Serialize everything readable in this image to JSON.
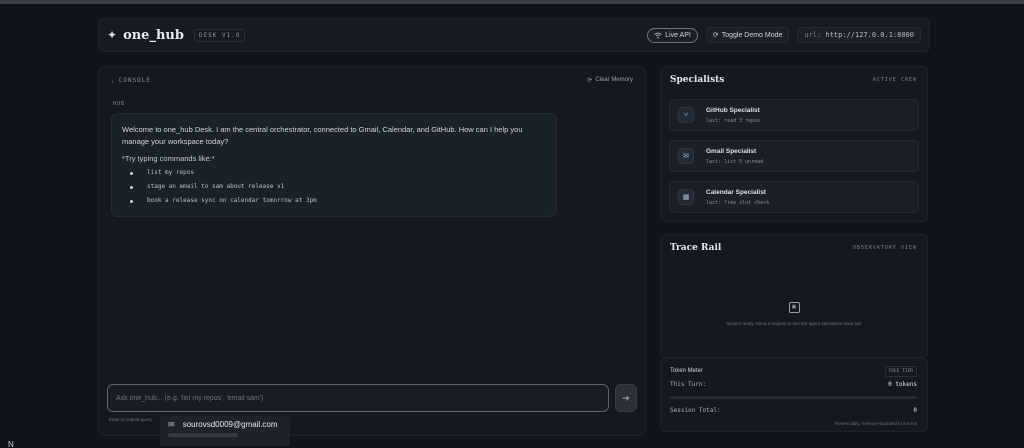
{
  "header": {
    "logo_glyph": "✦",
    "brand": "one_hub",
    "brand_tag": "DESK V1.0",
    "live_label": "Live API",
    "live_icon": "wifi-icon",
    "toggle_label": "Toggle Demo Mode",
    "toggle_icon": "refresh-icon",
    "url_key": "url:",
    "url_value": "http://127.0.0.1:8000"
  },
  "console": {
    "label": "CONSOLE",
    "clear_label": "Clear Memory",
    "message": {
      "role": "HUB",
      "text": "Welcome to one_hub Desk. I am the central orchestrator, connected to Gmail, Calendar, and GitHub. How can I help you manage your workspace today?",
      "hint": "*Try typing commands like:*",
      "commands": [
        "list my repos",
        "stage an email to sam about release v1",
        "book a release sync on calendar tomorrow at 3pm"
      ]
    },
    "input": {
      "value": "",
      "placeholder": "Ask one_hub... (e.g. 'list my repos', 'email sam')",
      "send_glyph": "➔",
      "hint": "Enter to submit query"
    },
    "autofill": {
      "email": "sourovsd0009@gmail.com",
      "icon": "mail-icon"
    }
  },
  "specialists": {
    "title": "Specialists",
    "tag": "ACTIVE CREW",
    "items": [
      {
        "name": "GitHub Specialist",
        "status": "last: read 3 repos",
        "icon": "git-branch-icon",
        "glyph": "⑂"
      },
      {
        "name": "Gmail Specialist",
        "status": "last: list 5 unread",
        "icon": "mail-icon",
        "glyph": "✉"
      },
      {
        "name": "Calendar Specialist",
        "status": "last: free slot check",
        "icon": "calendar-icon",
        "glyph": "▦"
      }
    ]
  },
  "trace": {
    "title": "Trace Rail",
    "tag": "OBSERVATORY VIEW",
    "empty_text": "System ready. Send a request to see the agent operations trace rail."
  },
  "token_meter": {
    "title": "Token Meter",
    "tier": "FREE TIER",
    "turn_label": "This Turn:",
    "turn_value": "0 tokens",
    "turn_fraction": 0.0,
    "session_label": "Session Total:",
    "session_value": "0",
    "note": "Resets daily, memory-bounded to 8 turns"
  }
}
